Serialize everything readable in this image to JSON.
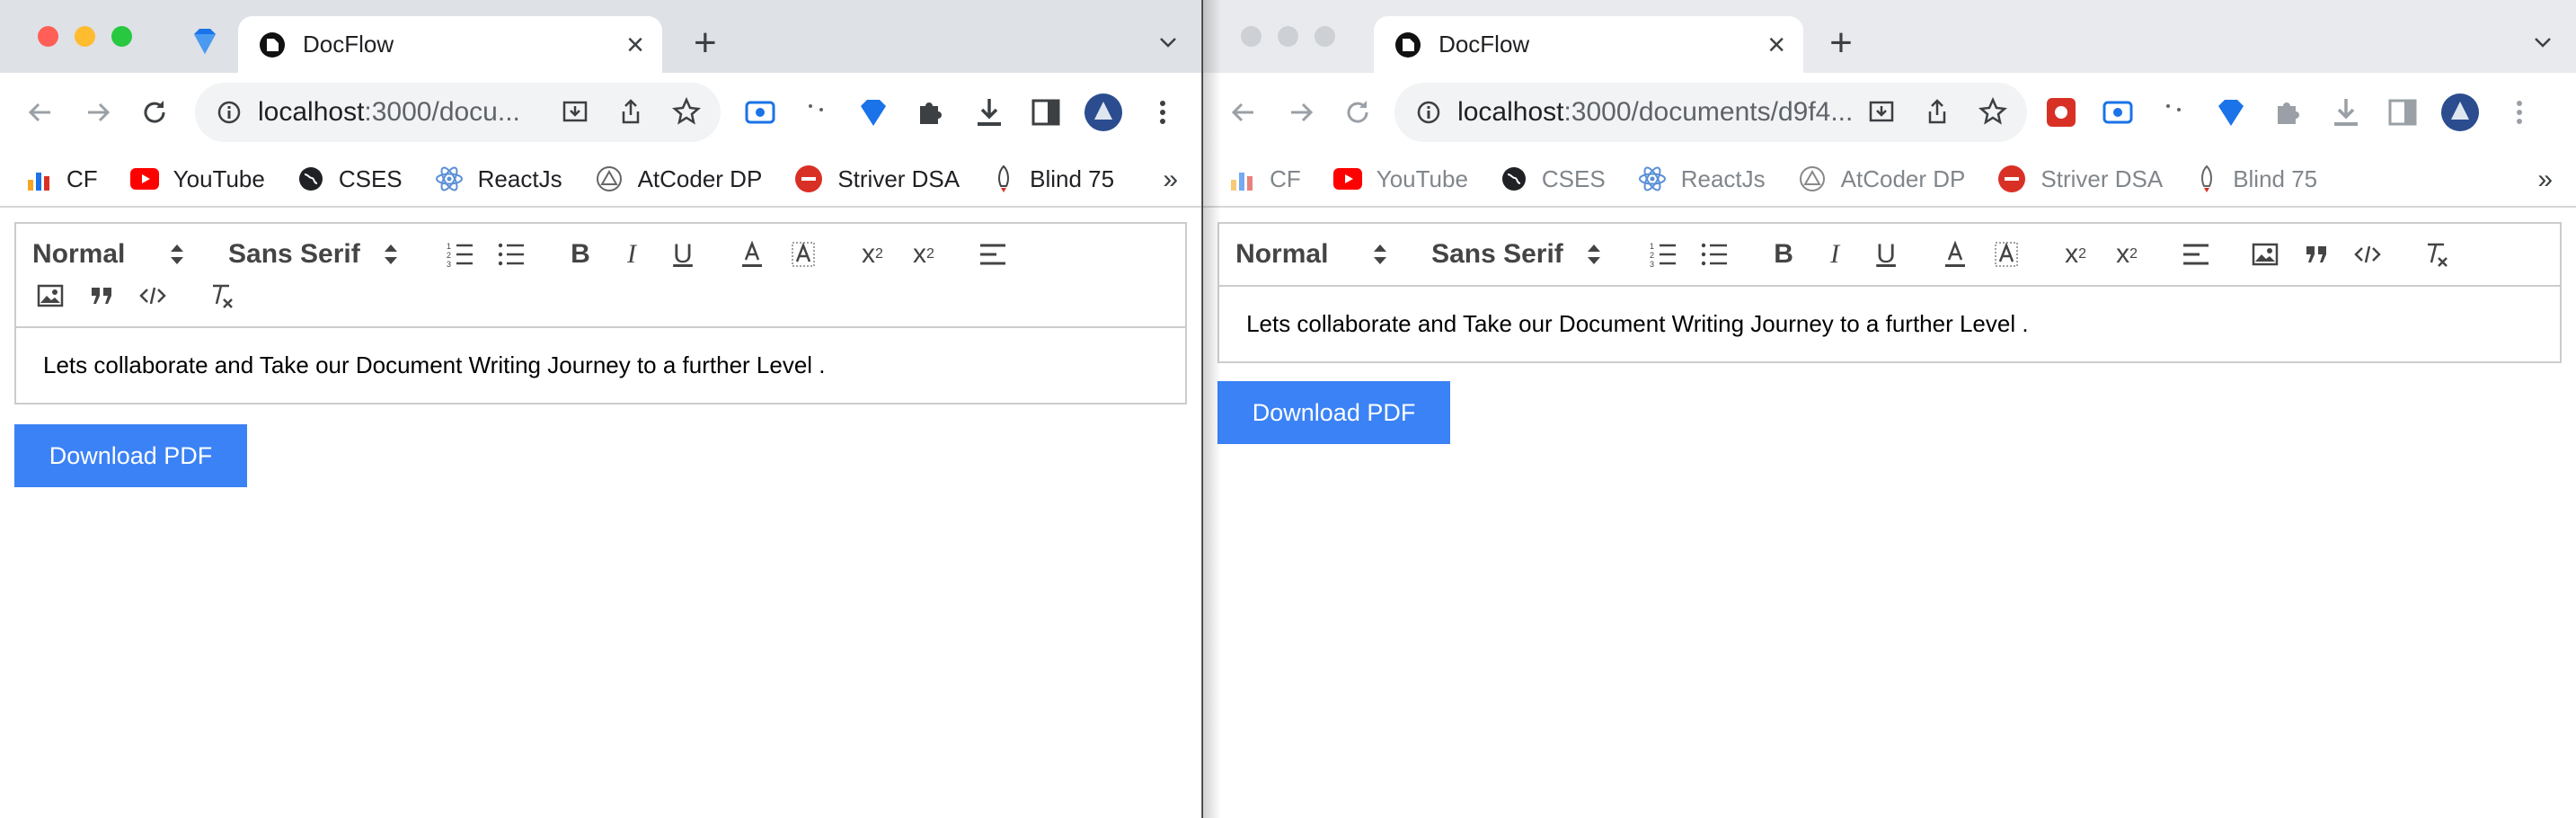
{
  "windows": [
    {
      "tab": {
        "title": "DocFlow"
      },
      "url": {
        "host": "localhost",
        "rest": ":3000/docu..."
      },
      "bookmarks": [
        "CF",
        "YouTube",
        "CSES",
        "ReactJs",
        "AtCoder DP",
        "Striver DSA",
        "Blind 75"
      ],
      "toolbar": {
        "header_picker": "Normal",
        "font_picker": "Sans Serif"
      },
      "editor": {
        "text": "Lets collaborate and Take our Document Writing Journey to a further Level ."
      },
      "download_label": "Download PDF"
    },
    {
      "tab": {
        "title": "DocFlow"
      },
      "url": {
        "host": "localhost",
        "rest": ":3000/documents/d9f4..."
      },
      "bookmarks": [
        "CF",
        "YouTube",
        "CSES",
        "ReactJs",
        "AtCoder DP",
        "Striver DSA",
        "Blind 75"
      ],
      "toolbar": {
        "header_picker": "Normal",
        "font_picker": "Sans Serif"
      },
      "editor": {
        "text": "Lets collaborate and Take our Document Writing Journey to a further Level ."
      },
      "download_label": "Download PDF"
    }
  ],
  "glyphs": {
    "new_tab": "+",
    "close_tab": "×",
    "more_bookmarks": "»",
    "bold": "B",
    "italic": "I",
    "underline": "U",
    "color": "A",
    "subscript_x": "x",
    "sub": "2",
    "superscript_x": "x",
    "sup": "2"
  },
  "colors": {
    "accent": "#3b82f6",
    "tab_strip": "#dee1e6"
  }
}
